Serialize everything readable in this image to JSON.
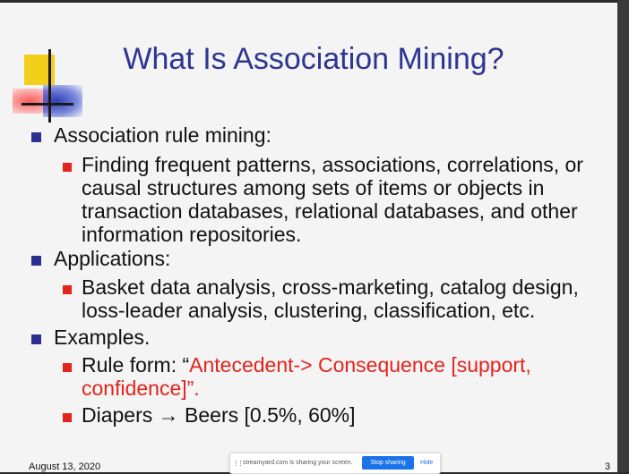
{
  "slide": {
    "title": "What Is Association Mining?",
    "bullets": [
      {
        "text": "Association rule mining:",
        "sub": "Finding frequent patterns, associations, correlations, or causal structures among sets of items or objects in transaction databases, relational databases, and other information repositories."
      },
      {
        "text": "Applications:",
        "sub": "Basket data analysis, cross-marketing, catalog design, loss-leader analysis, clustering, classification, etc."
      },
      {
        "text": "Examples.",
        "rule_prefix": "Rule form:  “",
        "rule_highlight_1": "Antecedent-> Consequence [support,",
        "rule_highlight_2": "confidence]”.",
        "example": "Diapers →  Beers [0.5%, 60%]"
      }
    ],
    "date": "August 13, 2020",
    "page_number": "3",
    "colors": {
      "title": "#2e3592",
      "highlight": "#e3231d",
      "bullet_l1": "#2b2f8f",
      "bullet_l2": "#e3231d"
    }
  },
  "share_bar": {
    "message": "streamyard.com is sharing your screen.",
    "stop_label": "Stop sharing",
    "hide_label": "Hide"
  }
}
